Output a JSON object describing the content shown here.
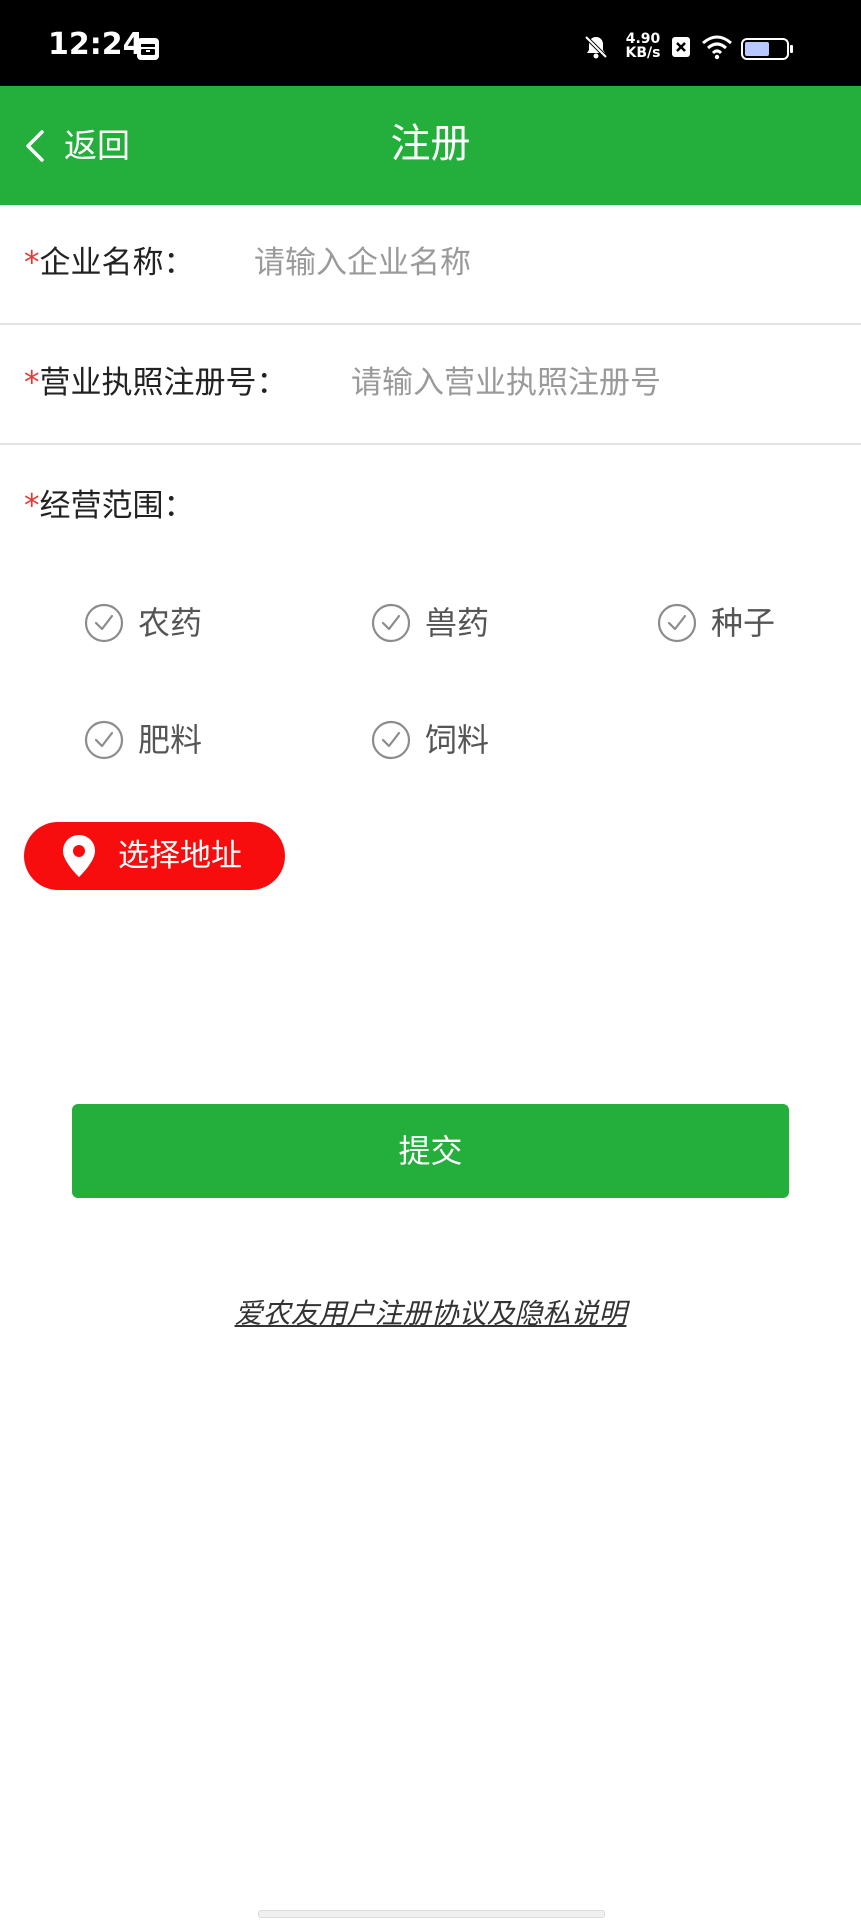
{
  "status_bar": {
    "time": "12:24",
    "net_speed_value": "4.90",
    "net_speed_unit": "KB/s",
    "icons": [
      "message-icon",
      "mute-bell-icon",
      "no-sim-icon",
      "wifi-icon",
      "battery-icon"
    ],
    "battery_level": 0.6
  },
  "nav": {
    "back_label": "返回",
    "title": "注册"
  },
  "form": {
    "required_mark": "*",
    "company_name": {
      "label": "企业名称：",
      "value": "",
      "placeholder": "请输入企业名称"
    },
    "license_no": {
      "label": "营业执照注册号：",
      "value": "",
      "placeholder": "请输入营业执照注册号"
    },
    "scope": {
      "label": "经营范围：",
      "options": [
        {
          "label": "农药",
          "checked": false
        },
        {
          "label": "兽药",
          "checked": false
        },
        {
          "label": "种子",
          "checked": false
        },
        {
          "label": "肥料",
          "checked": false
        },
        {
          "label": "饲料",
          "checked": false
        }
      ]
    },
    "address_button": "选择地址",
    "submit_label": "提交"
  },
  "agreement_link": "爱农友用户注册协议及隐私说明",
  "colors": {
    "primary_green": "#24ae3b",
    "address_red": "#f70d0d",
    "required_red": "#e53935",
    "placeholder_gray": "#9a9a9a"
  }
}
